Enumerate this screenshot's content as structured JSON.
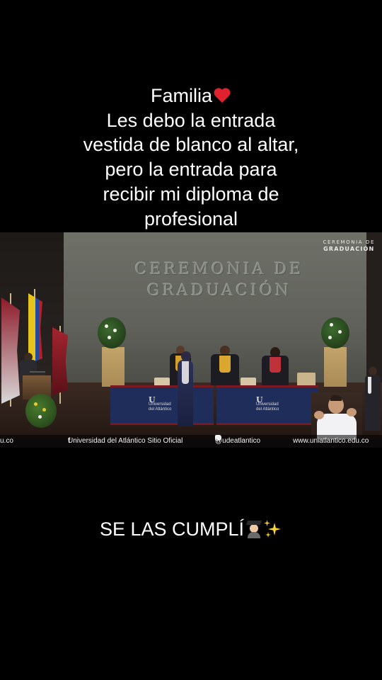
{
  "caption_top": {
    "line1": "Familia",
    "line2": "Les debo la entrada",
    "line3": "vestida de blanco al altar,",
    "line4": "pero la entrada para",
    "line5": "recibir mi diploma de",
    "line6": "profesional"
  },
  "video": {
    "backdrop_line1": "CEREMONIA DE",
    "backdrop_line2": "GRADUACIÓN",
    "corner_logo_line1": "CEREMONIA DE",
    "corner_logo_line2": "GRADUACIÓN",
    "table_logo_text": "Universidad del Atlántico",
    "footer": {
      "left_fragment": "u.co",
      "facebook": "Universidad del Atlántico Sitio Oficial",
      "social_handle": "@udeatlantico",
      "website": "www.uniatlantico.edu.co"
    }
  },
  "caption_bottom": {
    "text": "SE LAS CUMPLÍ"
  },
  "icons": {
    "heart": "red-heart-icon",
    "graduate": "woman-graduate-icon",
    "sparkles": "sparkles-icon"
  },
  "colors": {
    "background": "#000000",
    "text": "#ffffff",
    "heart": "#e0222e",
    "table": "#1f2d5a",
    "sparkles": "#ffd43b"
  }
}
